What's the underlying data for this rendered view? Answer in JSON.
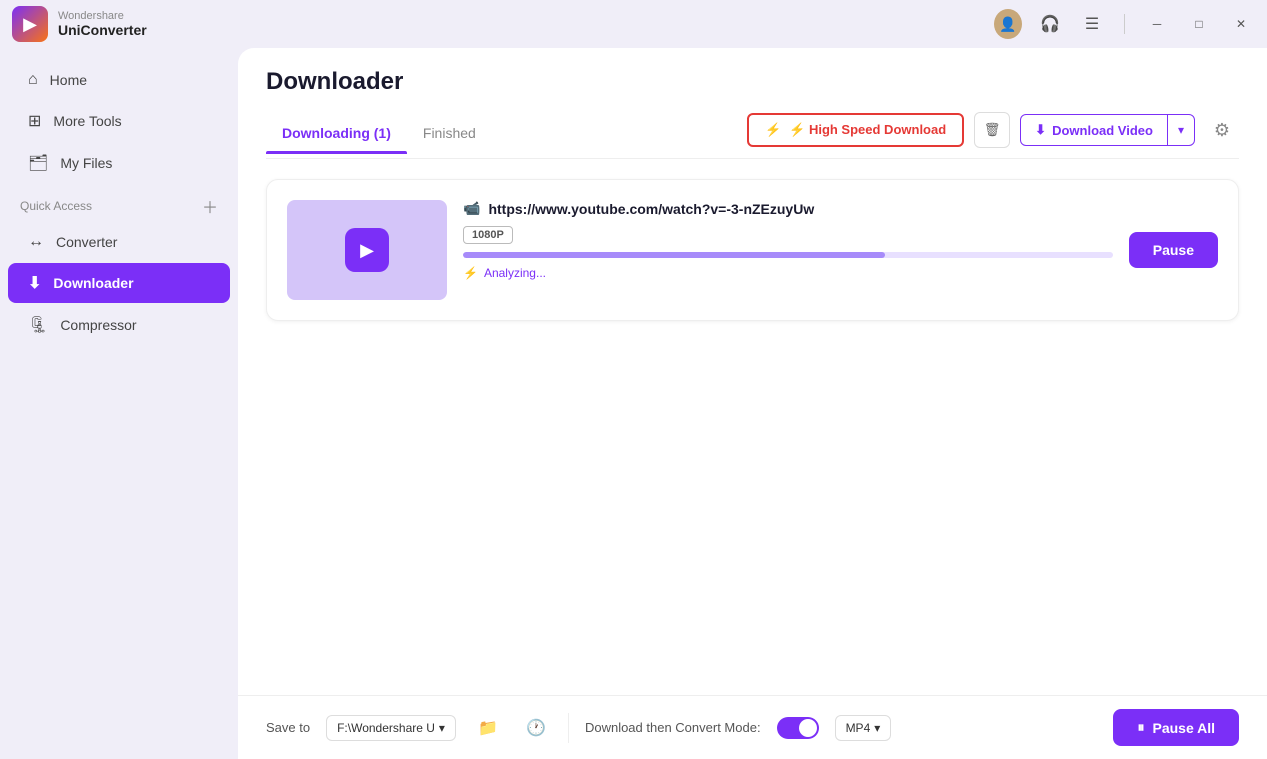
{
  "app": {
    "name": "Wondershare",
    "subtitle": "UniConverter",
    "logo_char": "▶"
  },
  "titlebar": {
    "icons": [
      "avatar",
      "headset",
      "menu"
    ],
    "window_controls": [
      "minimize",
      "maximize",
      "close"
    ]
  },
  "sidebar": {
    "nav_items": [
      {
        "id": "home",
        "label": "Home",
        "icon": "⌂",
        "active": false
      },
      {
        "id": "more-tools",
        "label": "More Tools",
        "icon": "⊞",
        "active": false
      },
      {
        "id": "my-files",
        "label": "My Files",
        "icon": "🗂",
        "active": false
      }
    ],
    "quick_access_label": "Quick Access",
    "quick_access_items": [
      {
        "id": "converter",
        "label": "Converter",
        "icon": "↔",
        "active": false
      },
      {
        "id": "downloader",
        "label": "Downloader",
        "icon": "📥",
        "active": true
      },
      {
        "id": "compressor",
        "label": "Compressor",
        "icon": "🗜",
        "active": false
      }
    ]
  },
  "content": {
    "page_title": "Downloader",
    "tabs": [
      {
        "id": "downloading",
        "label": "Downloading (1)",
        "active": true
      },
      {
        "id": "finished",
        "label": "Finished",
        "active": false
      }
    ],
    "toolbar": {
      "high_speed_label": "⚡ High Speed Download",
      "delete_icon": "🗑",
      "download_video_label": "Download Video",
      "download_icon": "⬇",
      "settings_icon": "⚙"
    },
    "download_items": [
      {
        "url": "https://www.youtube.com/watch?v=-3-nZEzuyUw",
        "quality": "1080P",
        "progress": 65,
        "status": "Analyzing...",
        "action_label": "Pause"
      }
    ]
  },
  "bottom_bar": {
    "save_to_label": "Save to",
    "save_path": "F:\\Wondershare U",
    "convert_mode_label": "Download then Convert Mode:",
    "format": "MP4",
    "pause_all_label": "Pause All",
    "pause_icon": "⏸"
  }
}
